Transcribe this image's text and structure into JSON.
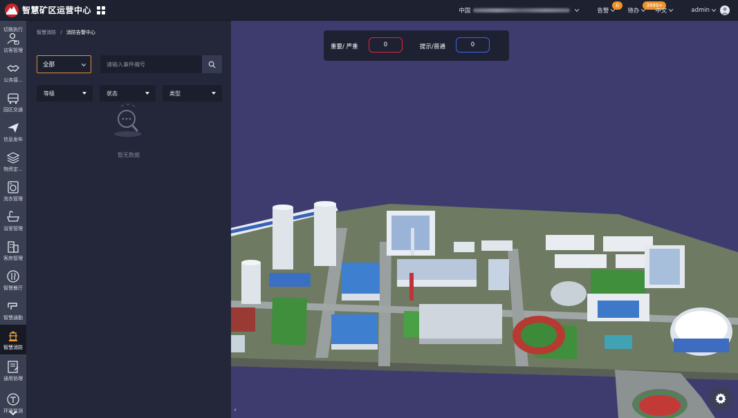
{
  "header": {
    "title": "智慧矿区运营中心",
    "region_label": "中国",
    "alerts_label": "告警",
    "alerts_count": "0",
    "todo_label": "待办",
    "todo_count": "3999+",
    "language_label": "中文",
    "user_name": "admin"
  },
  "sidebar": {
    "top_partial_label": "切换执行",
    "items": [
      {
        "label": "访客管理",
        "icon": "visitor-icon"
      },
      {
        "label": "公务接...",
        "icon": "handshake-icon"
      },
      {
        "label": "园区交通",
        "icon": "car-icon"
      },
      {
        "label": "信息发布",
        "icon": "send-icon"
      },
      {
        "label": "物资定...",
        "icon": "layers-icon"
      },
      {
        "label": "洗衣管理",
        "icon": "washer-icon"
      },
      {
        "label": "浴室管理",
        "icon": "bathtub-icon"
      },
      {
        "label": "客房管理",
        "icon": "building-icon"
      },
      {
        "label": "智慧餐厅",
        "icon": "dining-icon"
      },
      {
        "label": "智慧通勤",
        "icon": "commute-icon"
      },
      {
        "label": "智慧消防",
        "icon": "hydrant-icon",
        "active": true
      },
      {
        "label": "通用协理",
        "icon": "form-icon"
      },
      {
        "label": "环境监测",
        "icon": "environment-icon"
      }
    ]
  },
  "panel": {
    "breadcrumb_root": "智慧消防",
    "breadcrumb_sep": "/",
    "breadcrumb_current": "消防告警中心",
    "scope_select": "全部",
    "search_placeholder": "请输入事件编号",
    "filters": [
      "等级",
      "状态",
      "类型"
    ],
    "empty_text": "暂无数据"
  },
  "scene": {
    "stats": [
      {
        "label": "重要/ 严重",
        "value": "0",
        "color": "#e0283a"
      },
      {
        "label": "提示/普通",
        "value": "0",
        "color": "#3f64e8"
      }
    ],
    "collapse_glyph": "‹"
  }
}
